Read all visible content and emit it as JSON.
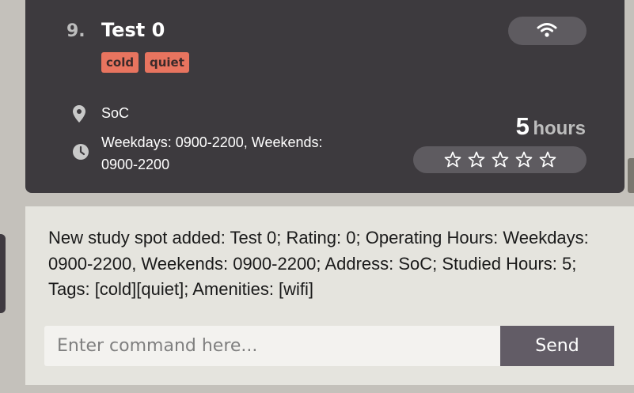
{
  "study_spot": {
    "index": "9.",
    "name": "Test 0",
    "tags": [
      "cold",
      "quiet"
    ],
    "amenities": [
      {
        "icon": "wifi-icon"
      }
    ],
    "address": "SoC",
    "operating_hours": "Weekdays: 0900-2200, Weekends: 0900-2200",
    "studied_hours": "5",
    "studied_hours_unit": "hours",
    "rating": 0,
    "rating_max": 5,
    "icons": {
      "address": "location-pin-icon",
      "hours": "clock-icon",
      "rating": "star-outline-icon"
    }
  },
  "result_display": {
    "message": "New study spot added: Test 0; Rating: 0; Operating Hours: Weekdays: 0900-2200, Weekends: 0900-2200; Address: SoC; Studied Hours: 5; Tags: [cold][quiet]; Amenities: [wifi]"
  },
  "command_box": {
    "value": "",
    "placeholder": "Enter command here...",
    "send_label": "Send"
  },
  "colors": {
    "background": "#c4c1bb",
    "card": "#3d3a3e",
    "tag": "#e8745f",
    "pill": "#5e5b60",
    "result_panel": "#e5e4de",
    "send_button": "#625c66"
  }
}
